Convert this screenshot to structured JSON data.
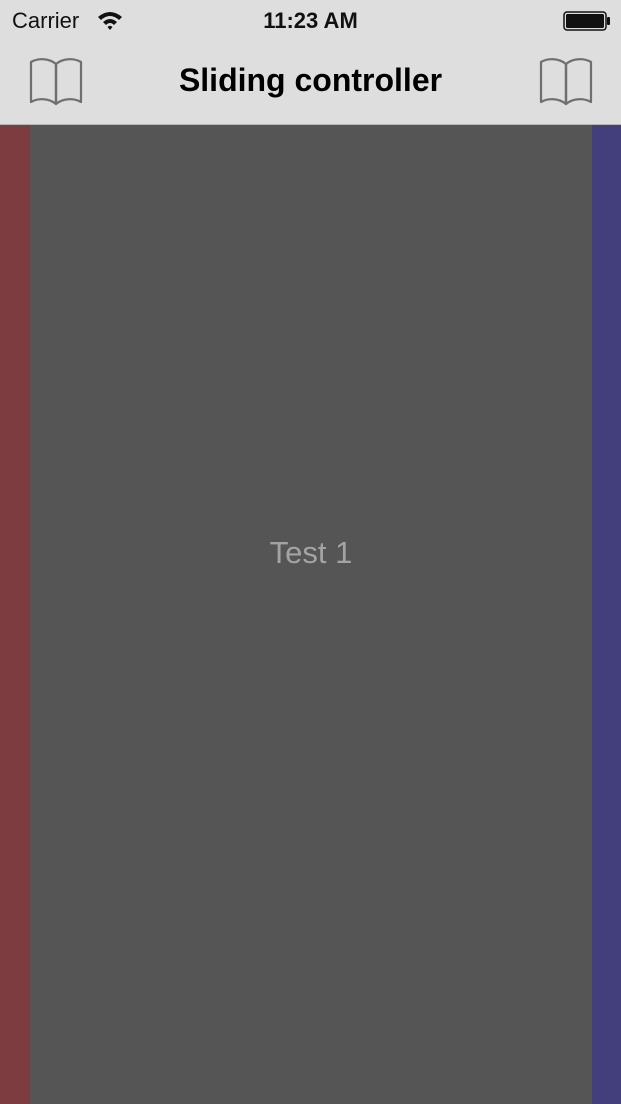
{
  "status_bar": {
    "carrier": "Carrier",
    "time": "11:23 AM",
    "wifi_icon": "wifi-icon",
    "battery_icon": "battery-icon"
  },
  "nav_bar": {
    "title": "Sliding controller",
    "left_button_icon": "book-icon",
    "right_button_icon": "book-icon"
  },
  "content": {
    "label": "Test 1"
  },
  "colors": {
    "left_panel": "#7d3c3f",
    "right_panel": "#433f7d",
    "center_panel": "#555555",
    "nav_background": "#dedede",
    "label_text": "#a3a3a3"
  }
}
